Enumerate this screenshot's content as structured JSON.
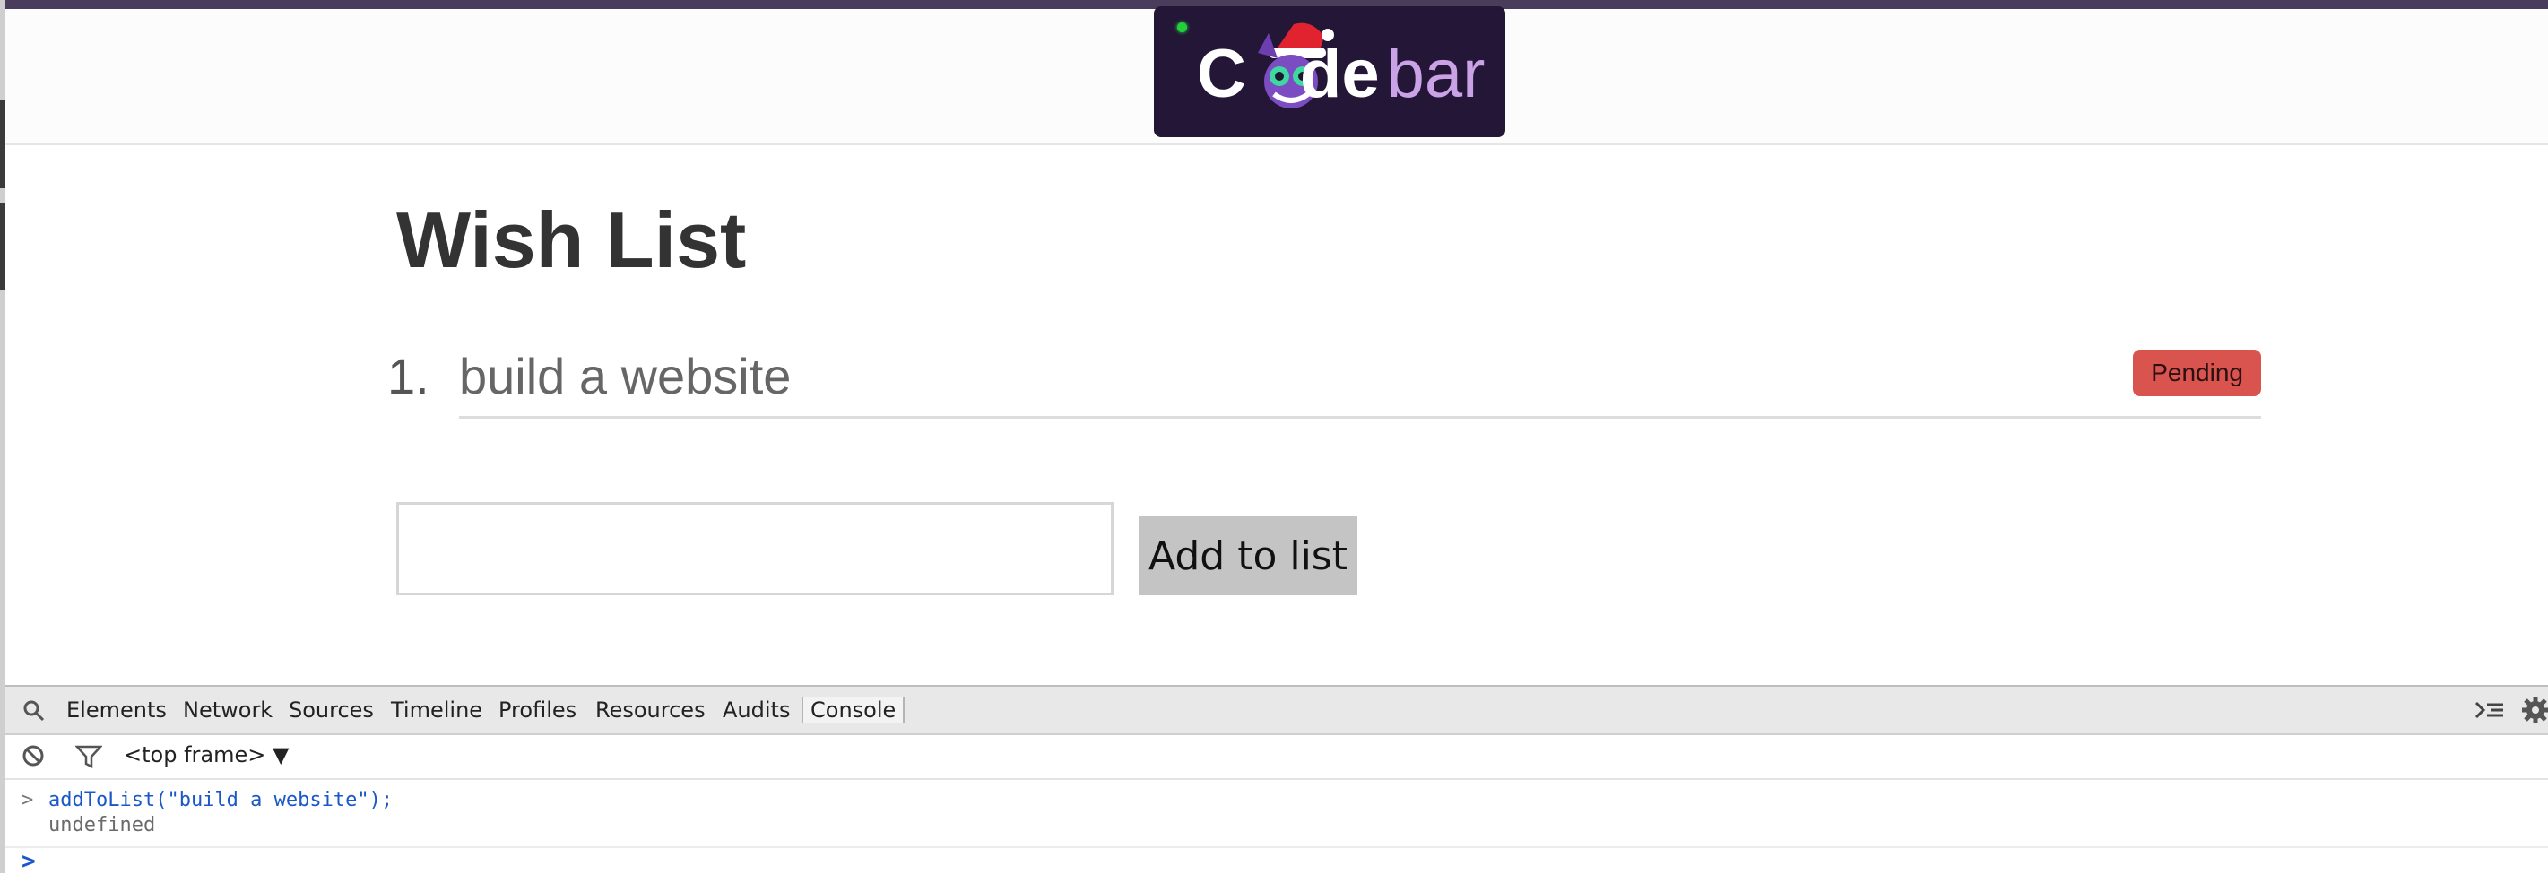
{
  "header": {
    "logo": {
      "text_prefix": "C",
      "text_middle": "de",
      "text_suffix": "bar",
      "brand_color": "#231636",
      "accent_color": "#c9a3e6"
    }
  },
  "page": {
    "title": "Wish List",
    "items": [
      {
        "number": "1.",
        "text": "build a website",
        "status": "Pending",
        "status_color": "#d9534f"
      }
    ],
    "input": {
      "value": "",
      "placeholder": ""
    },
    "add_button_label": "Add to list"
  },
  "devtools": {
    "tabs": [
      "Elements",
      "Network",
      "Sources",
      "Timeline",
      "Profiles",
      "Resources",
      "Audits",
      "Console"
    ],
    "active_tab": "Console",
    "frame_selector": "<top frame>",
    "frame_selector_arrow": "▼",
    "console": {
      "input_prompt": ">",
      "command": "addToList(\"build a website\");",
      "result": "undefined",
      "caret": ">"
    }
  }
}
